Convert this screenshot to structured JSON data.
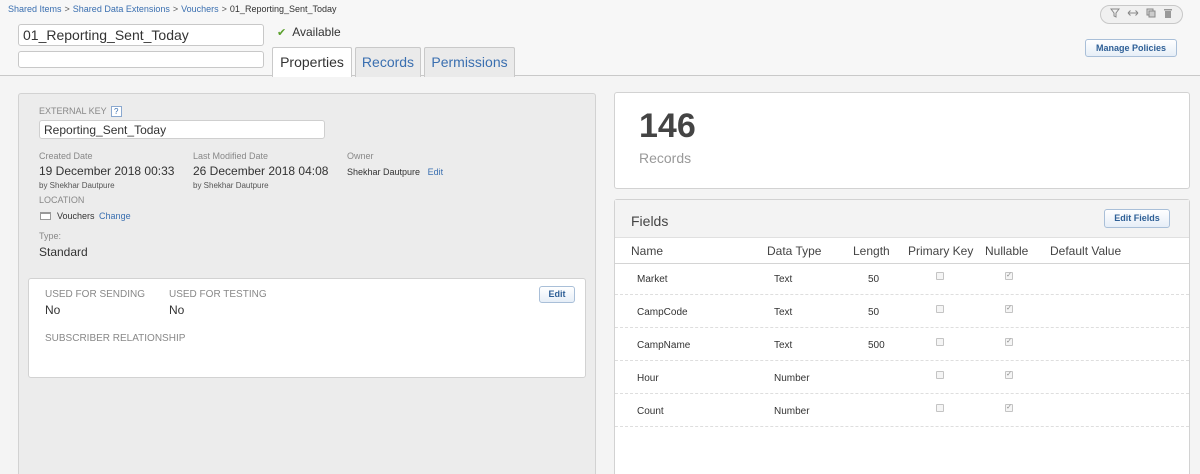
{
  "breadcrumb": {
    "items": [
      "Shared Items",
      "Shared Data Extensions",
      "Vouchers"
    ],
    "separator": ">",
    "current": "01_Reporting_Sent_Today"
  },
  "header": {
    "name_value": "01_Reporting_Sent_Today",
    "description_value": "",
    "status": "Available",
    "manage_policies_label": "Manage Policies"
  },
  "tabs": [
    {
      "label": "Properties",
      "active": true
    },
    {
      "label": "Records",
      "active": false
    },
    {
      "label": "Permissions",
      "active": false
    }
  ],
  "toolbar": {
    "icons": [
      "filter-icon",
      "arrows-icon",
      "copy-icon",
      "trash-icon"
    ]
  },
  "properties": {
    "external_key_label": "EXTERNAL KEY",
    "help_glyph": "?",
    "external_key_value": "Reporting_Sent_Today",
    "created_label": "Created Date",
    "created_value": "19 December 2018 00:33",
    "created_by": "by Shekhar Dautpure",
    "modified_label": "Last Modified Date",
    "modified_value": "26 December 2018 04:08",
    "modified_by": "by Shekhar Dautpure",
    "owner_label": "Owner",
    "owner_value": "Shekhar Dautpure",
    "owner_edit": "Edit",
    "location_label": "LOCATION",
    "location_value": "Vouchers",
    "location_change": "Change",
    "type_label": "Type:",
    "type_value": "Standard"
  },
  "sending": {
    "used_for_sending_label": "USED FOR SENDING",
    "used_for_sending_value": "No",
    "used_for_testing_label": "USED FOR TESTING",
    "used_for_testing_value": "No",
    "subscriber_label": "SUBSCRIBER RELATIONSHIP",
    "edit_label": "Edit"
  },
  "records": {
    "count": "146",
    "label": "Records"
  },
  "fields": {
    "title": "Fields",
    "edit_label": "Edit Fields",
    "columns": [
      "Name",
      "Data Type",
      "Length",
      "Primary Key",
      "Nullable",
      "Default Value"
    ],
    "rows": [
      {
        "name": "Market",
        "type": "Text",
        "length": "50",
        "primary_key": false,
        "nullable": true
      },
      {
        "name": "CampCode",
        "type": "Text",
        "length": "50",
        "primary_key": false,
        "nullable": true
      },
      {
        "name": "CampName",
        "type": "Text",
        "length": "500",
        "primary_key": false,
        "nullable": true
      },
      {
        "name": "Hour",
        "type": "Number",
        "length": "",
        "primary_key": false,
        "nullable": true
      },
      {
        "name": "Count",
        "type": "Number",
        "length": "",
        "primary_key": false,
        "nullable": true
      }
    ]
  },
  "colors": {
    "link": "#3a6fb0",
    "check": "#5aa02c"
  }
}
